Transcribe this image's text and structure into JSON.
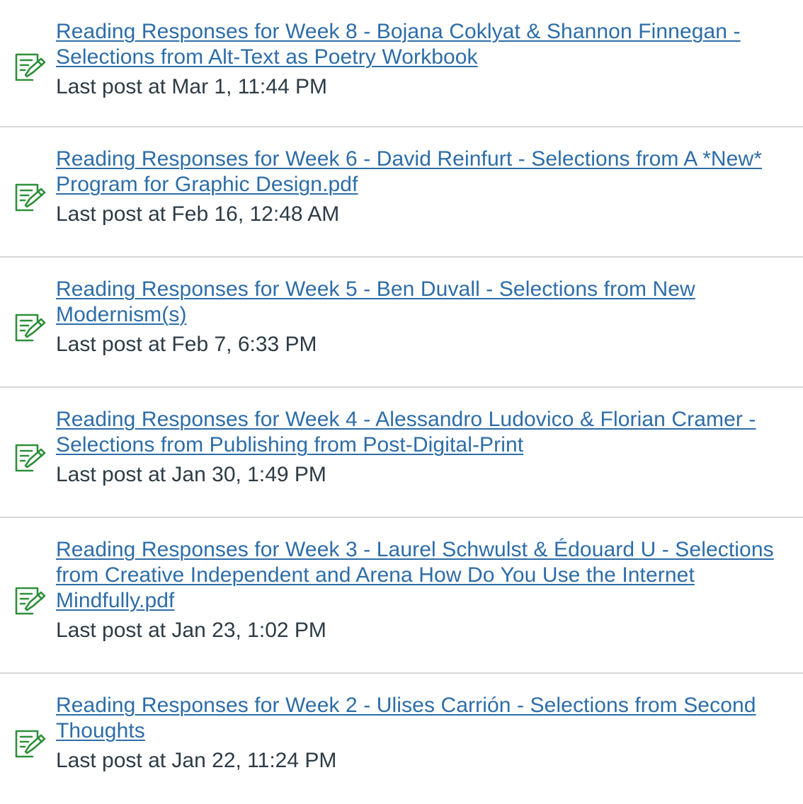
{
  "discussions": [
    {
      "title": "Reading Responses for Week 8 - Bojana Coklyat & Shannon Finnegan - Selections from Alt-Text as Poetry Workbook",
      "last_post": "Last post at Mar 1, 11:44 PM"
    },
    {
      "title": "Reading Responses for Week 6 - David Reinfurt - Selections from A *New* Program for Graphic Design.pdf",
      "last_post": "Last post at Feb 16, 12:48 AM"
    },
    {
      "title": "Reading Responses for Week 5 - Ben Duvall - Selections from New Modernism(s)",
      "last_post": "Last post at Feb 7, 6:33 PM"
    },
    {
      "title": "Reading Responses for Week 4 - Alessandro Ludovico & Florian Cramer - Selections from Publishing from Post-Digital-Print",
      "last_post": "Last post at Jan 30, 1:49 PM"
    },
    {
      "title": "Reading Responses for Week 3 - Laurel Schwulst & Édouard U - Selections from Creative Independent and Arena How Do You Use the Internet Mindfully.pdf",
      "last_post": "Last post at Jan 23, 1:02 PM"
    },
    {
      "title": "Reading Responses for Week 2 - Ulises Carrión - Selections from Second Thoughts",
      "last_post": "Last post at Jan 22, 11:24 PM"
    }
  ],
  "icon": {
    "name": "discussion-icon",
    "color": "#2e8f3a"
  },
  "colors": {
    "link": "#2d6da8",
    "text": "#2d3b45",
    "divider": "#d7d7d7"
  }
}
